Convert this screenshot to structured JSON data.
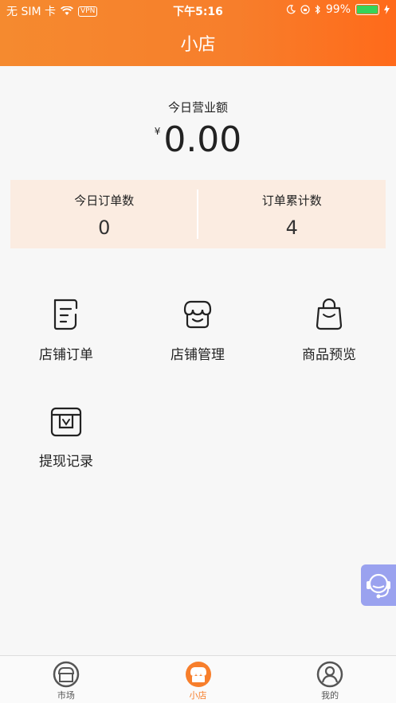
{
  "status_bar": {
    "carrier": "无 SIM 卡",
    "vpn": "VPN",
    "time": "下午5:16",
    "battery": "99%"
  },
  "header": {
    "title": "小店"
  },
  "revenue": {
    "label": "今日营业额",
    "currency": "¥",
    "amount": "0.00"
  },
  "stats": {
    "today_orders_label": "今日订单数",
    "today_orders_value": "0",
    "total_orders_label": "订单累计数",
    "total_orders_value": "4"
  },
  "menu": {
    "shop_orders": "店铺订单",
    "shop_manage": "店铺管理",
    "product_preview": "商品预览",
    "withdraw_records": "提现记录"
  },
  "tabbar": {
    "market": "市场",
    "shop": "小店",
    "mine": "我的"
  },
  "colors": {
    "accent": "#f77e2b",
    "stats_bg": "#fbece1",
    "float_bg": "#9aa2ef"
  }
}
